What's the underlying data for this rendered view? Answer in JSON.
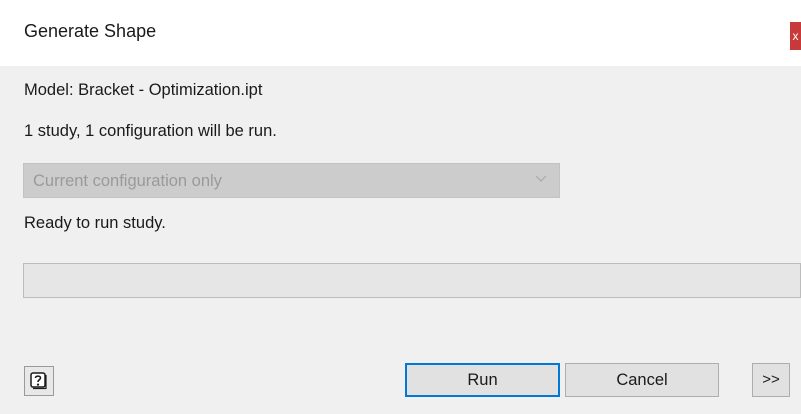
{
  "window": {
    "title": "Generate Shape",
    "close_label": "x"
  },
  "info": {
    "model_line": "Model: Bracket - Optimization.ipt",
    "run_summary": "1 study, 1 configuration will be run.",
    "status": "Ready to run study."
  },
  "configuration_select": {
    "selected": "Current configuration only",
    "enabled": false
  },
  "progress": {
    "value_percent": 0
  },
  "buttons": {
    "run": "Run",
    "cancel": "Cancel",
    "expand": ">>"
  },
  "icons": {
    "help": "help-question-icon",
    "dropdown": "chevron-down-icon"
  },
  "colors": {
    "close_button": "#c83a3a",
    "default_button_border": "#0078d7",
    "disabled_select": "#cccccc"
  }
}
